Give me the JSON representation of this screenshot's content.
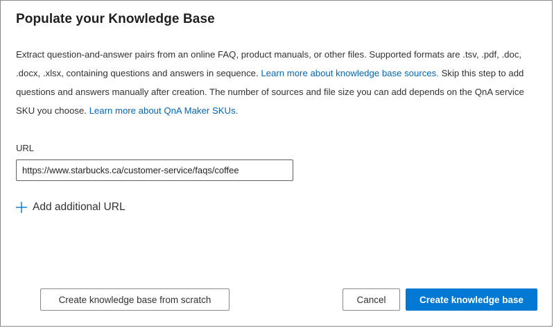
{
  "dialog": {
    "title": "Populate your Knowledge Base",
    "description": {
      "text1": "Extract question-and-answer pairs from an online FAQ, product manuals, or other files. Supported formats are .tsv, .pdf, .doc, .docx, .xlsx, containing questions and answers in sequence. ",
      "link1": "Learn more about knowledge base sources.",
      "text2": " Skip this step to add questions and answers manually after creation. The number of sources and file size you can add depends on the QnA service SKU you choose. ",
      "link2": "Learn more about QnA Maker SKUs."
    },
    "url_label": "URL",
    "url_value": "https://www.starbucks.ca/customer-service/faqs/coffee",
    "add_url_label": "Add additional URL",
    "icons": {
      "add": "plus-icon"
    },
    "colors": {
      "primary": "#0078d4",
      "link": "#0067b8"
    }
  },
  "buttons": {
    "scratch_label": "Create knowledge base from scratch",
    "cancel_label": "Cancel",
    "create_label": "Create knowledge base"
  }
}
